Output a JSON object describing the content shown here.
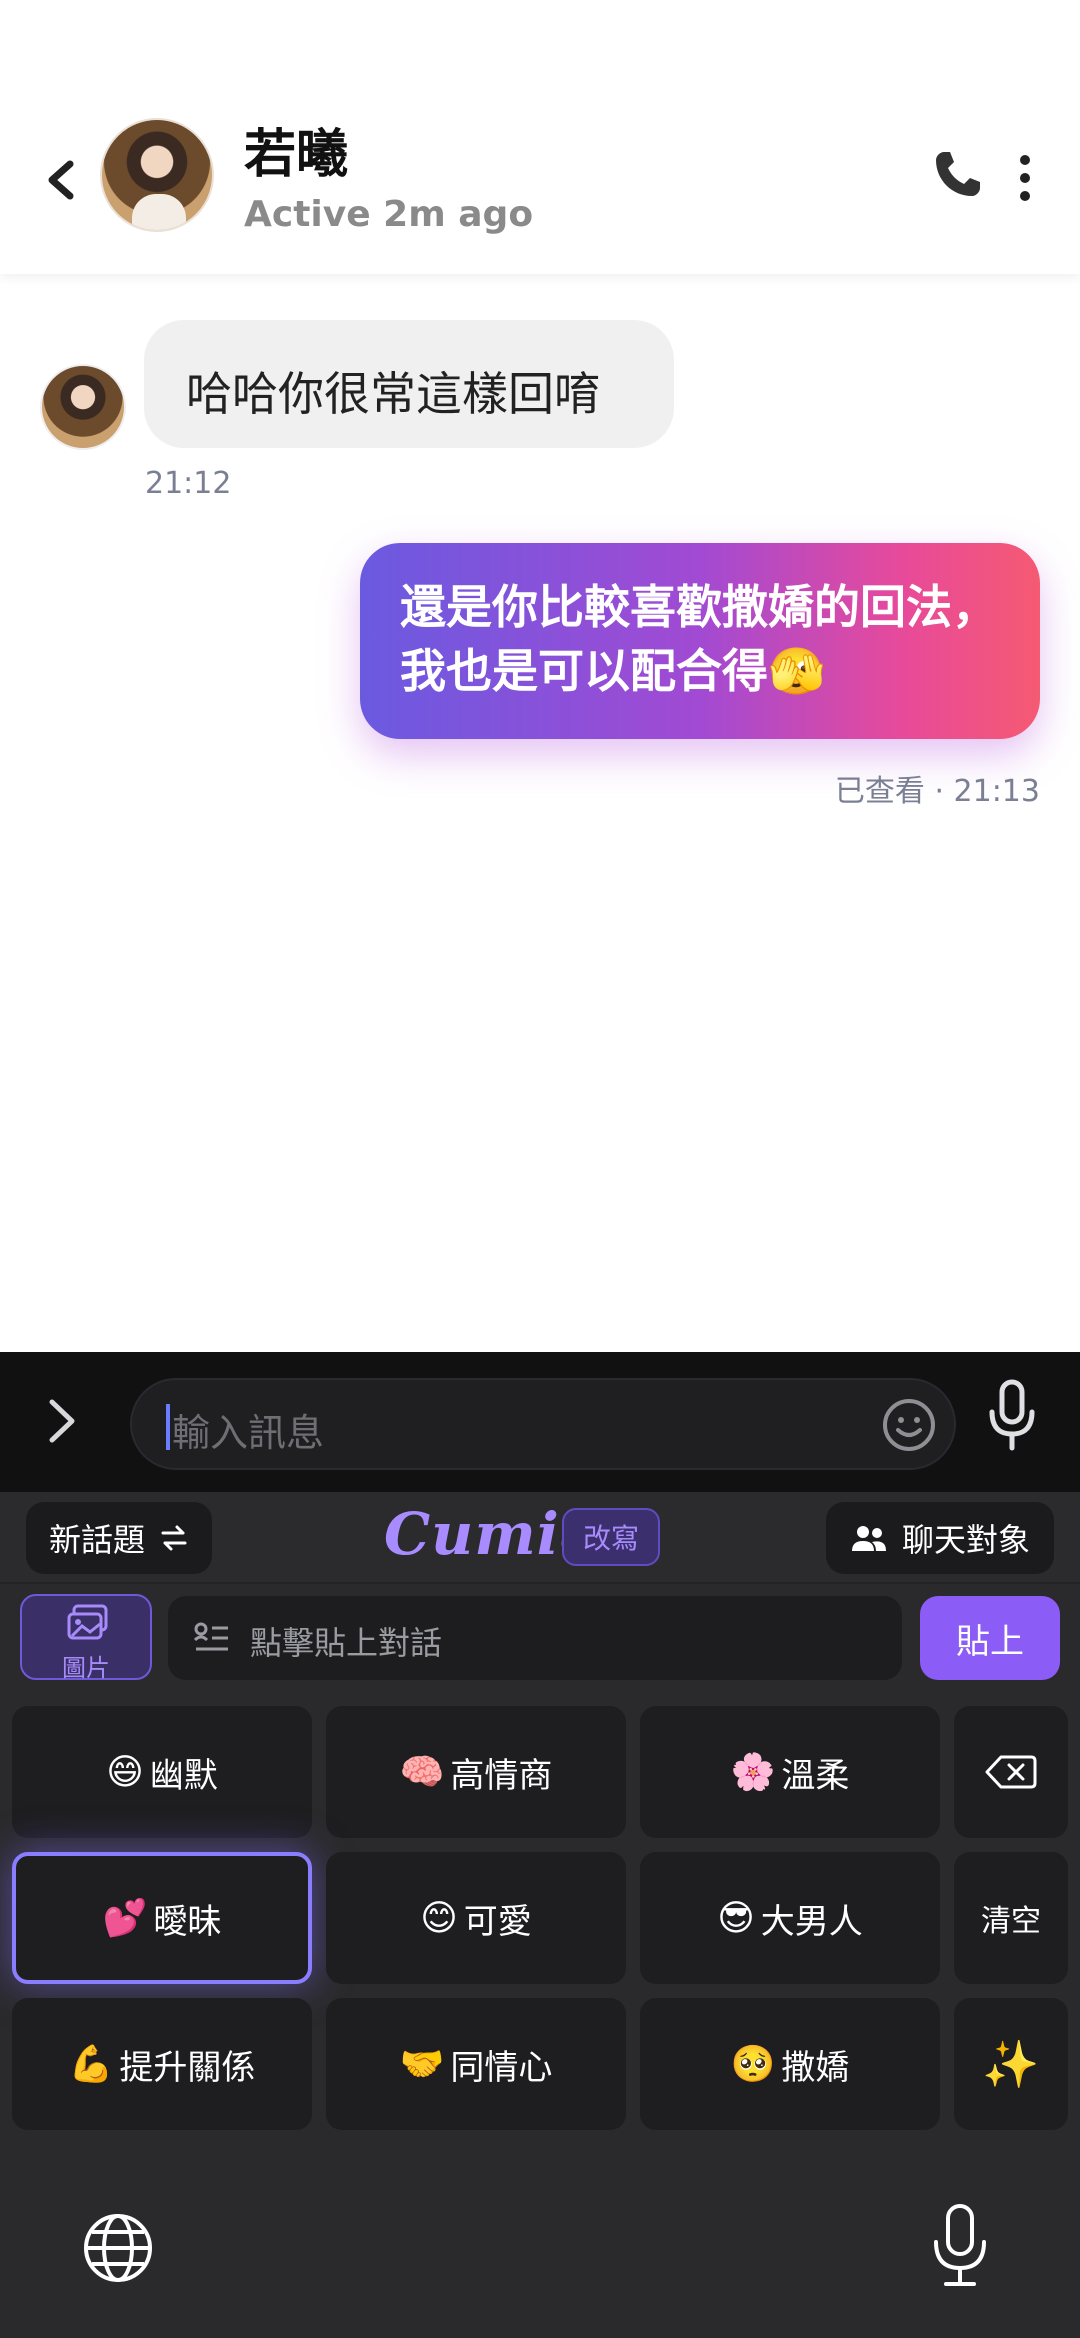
{
  "header": {
    "back_label": "‹",
    "name": "若曦",
    "status": "Active 2m ago"
  },
  "messages": [
    {
      "direction": "in",
      "text": "哈哈你很常這樣回唷",
      "time": "21:12"
    },
    {
      "direction": "out",
      "text": "還是你比較喜歡撒嬌的回法，我也是可以配合得🫣",
      "status": "已查看 · 21:13"
    }
  ],
  "input": {
    "placeholder": "輸入訊息"
  },
  "keyboard": {
    "new_topic_label": "新話題",
    "brand": "Cumie",
    "rewrite_label": "改寫",
    "chat_target_label": "聊天對象",
    "image_label": "圖片",
    "paste_placeholder": "點擊貼上對話",
    "paste_label": "貼上",
    "tones": [
      {
        "emoji": "😄",
        "label": "幽默"
      },
      {
        "emoji": "🧠",
        "label": "高情商"
      },
      {
        "emoji": "🌸",
        "label": "溫柔"
      },
      {
        "emoji": "💕",
        "label": "曖昧"
      },
      {
        "emoji": "😊",
        "label": "可愛"
      },
      {
        "emoji": "😎",
        "label": "大男人"
      },
      {
        "emoji": "💪",
        "label": "提升關係"
      },
      {
        "emoji": "🤝",
        "label": "同情心"
      },
      {
        "emoji": "🥺",
        "label": "撒嬌"
      }
    ],
    "selected_tone": "曖昧",
    "clear_label": "清空",
    "sparkle": "✨"
  },
  "colors": {
    "accent": "#8b5cf6",
    "bubble_out_start": "#6a5ae0",
    "bubble_out_end": "#f55a72",
    "keyboard_bg": "#2a2a2c"
  }
}
